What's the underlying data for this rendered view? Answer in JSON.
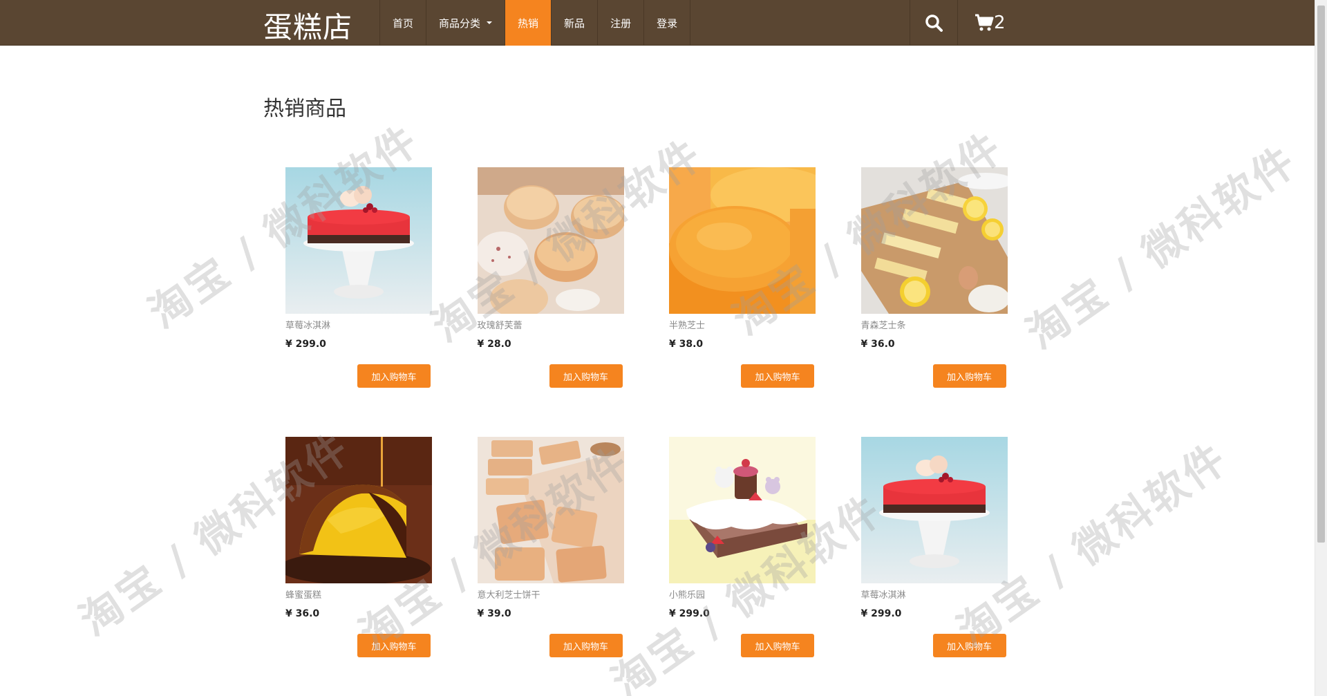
{
  "header": {
    "brand": "蛋糕店",
    "nav": [
      {
        "label": "首页",
        "active": false
      },
      {
        "label": "商品分类",
        "active": false,
        "dropdown": true
      },
      {
        "label": "热销",
        "active": true
      },
      {
        "label": "新品",
        "active": false
      },
      {
        "label": "注册",
        "active": false
      },
      {
        "label": "登录",
        "active": false
      }
    ],
    "search_icon": "search-icon",
    "cart_icon": "cart-icon",
    "cart_count": "2"
  },
  "main": {
    "section_title": "热销商品",
    "add_to_cart_label": "加入购物车",
    "products": [
      {
        "name": "草莓冰淇淋",
        "price": "¥ 299.0",
        "image": "red-mousse-cake-on-stand"
      },
      {
        "name": "玫瑰舒芙蕾",
        "price": "¥ 28.0",
        "image": "souffle-buns"
      },
      {
        "name": "半熟芝士",
        "price": "¥ 38.0",
        "image": "half-baked-cheesecake"
      },
      {
        "name": "青森芝士条",
        "price": "¥ 36.0",
        "image": "cheese-bars-with-lemon"
      },
      {
        "name": "蜂蜜蛋糕",
        "price": "¥ 36.0",
        "image": "honey-sponge-cake"
      },
      {
        "name": "意大利芝士饼干",
        "price": "¥ 39.0",
        "image": "cheese-biscuits"
      },
      {
        "name": "小熊乐园",
        "price": "¥ 299.0",
        "image": "bear-cream-cake"
      },
      {
        "name": "草莓冰淇淋",
        "price": "¥ 299.0",
        "image": "red-mousse-cake-on-stand"
      }
    ]
  },
  "watermark": "淘宝 / 微科软件",
  "colors": {
    "navbar": "#5a4632",
    "accent": "#f5841f",
    "brand_text": "#ffffff"
  }
}
